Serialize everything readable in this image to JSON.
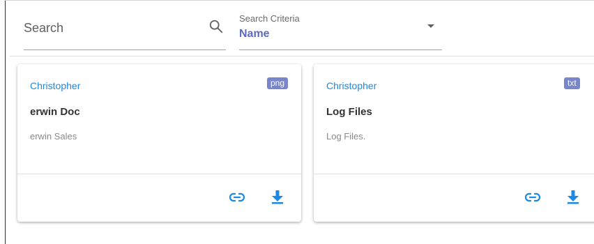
{
  "search": {
    "placeholder": "Search",
    "value": ""
  },
  "criteria": {
    "label": "Search Criteria",
    "selected": "Name"
  },
  "cards": [
    {
      "author": "Christopher",
      "file_type": "png",
      "title": "erwin Doc",
      "description": "erwin Sales",
      "actions": [
        "link-icon",
        "download-icon"
      ]
    },
    {
      "author": "Christopher",
      "file_type": "txt",
      "title": "Log Files",
      "description": "Log Files.",
      "actions": [
        "link-icon",
        "download-icon"
      ]
    }
  ],
  "colors": {
    "accent": "#1e88e5",
    "select_value": "#5c6bc0",
    "badge": "#7986cb",
    "title_text": "#333333",
    "muted_text": "#8a8a8a"
  }
}
